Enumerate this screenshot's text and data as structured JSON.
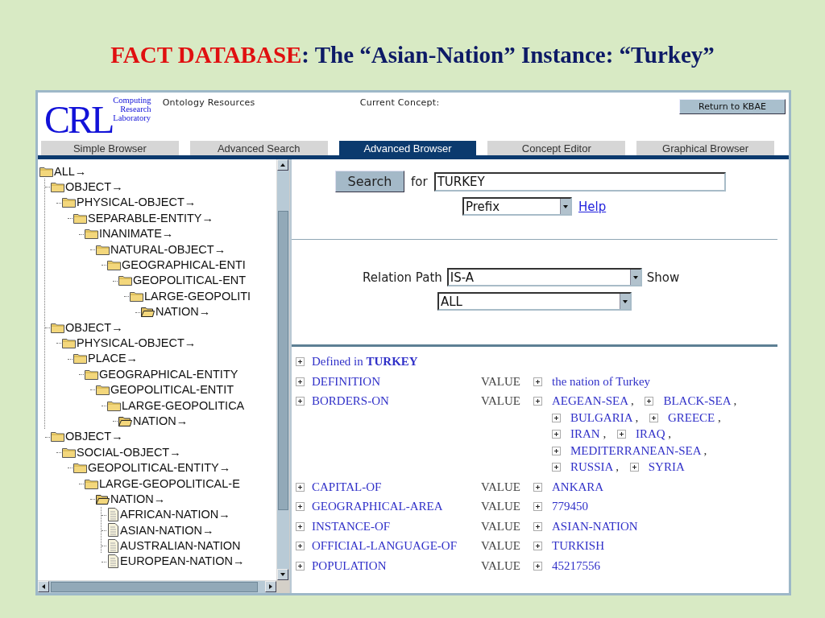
{
  "slide_title": {
    "highlight": "FACT DATABASE",
    "text": ": The “Asian-Nation” Instance: “Turkey”"
  },
  "header": {
    "logo": "CRL",
    "logo_lines": [
      "Computing",
      "Research",
      "Laboratory"
    ],
    "labels": [
      "Ontology Resources",
      "Current Concept:"
    ],
    "button": "Return to KBAE"
  },
  "tabs": [
    {
      "label": "Simple Browser",
      "selected": false
    },
    {
      "label": "Advanced Search",
      "selected": false
    },
    {
      "label": "Advanced Browser",
      "selected": true
    },
    {
      "label": "Concept Editor",
      "selected": false
    },
    {
      "label": "Graphical Browser",
      "selected": false
    }
  ],
  "tree": [
    {
      "label": "ALL→",
      "kind": "folder",
      "children": [
        {
          "label": "OBJECT→",
          "kind": "folder",
          "children": [
            {
              "label": "PHYSICAL-OBJECT→",
              "kind": "folder",
              "children": [
                {
                  "label": "SEPARABLE-ENTITY→",
                  "kind": "folder",
                  "children": [
                    {
                      "label": "INANIMATE→",
                      "kind": "folder",
                      "children": [
                        {
                          "label": "NATURAL-OBJECT→",
                          "kind": "folder",
                          "children": [
                            {
                              "label": "GEOGRAPHICAL-ENTI",
                              "kind": "folder",
                              "children": [
                                {
                                  "label": "GEOPOLITICAL-ENT",
                                  "kind": "folder",
                                  "children": [
                                    {
                                      "label": "LARGE-GEOPOLITI",
                                      "kind": "folder",
                                      "children": [
                                        {
                                          "label": "NATION→",
                                          "kind": "open"
                                        }
                                      ]
                                    }
                                  ]
                                }
                              ]
                            }
                          ]
                        }
                      ]
                    }
                  ]
                }
              ]
            }
          ]
        },
        {
          "label": "OBJECT→",
          "kind": "folder",
          "children": [
            {
              "label": "PHYSICAL-OBJECT→",
              "kind": "folder",
              "children": [
                {
                  "label": "PLACE→",
                  "kind": "folder",
                  "children": [
                    {
                      "label": "GEOGRAPHICAL-ENTITY",
                      "kind": "folder",
                      "children": [
                        {
                          "label": "GEOPOLITICAL-ENTIT",
                          "kind": "folder",
                          "children": [
                            {
                              "label": "LARGE-GEOPOLITICA",
                              "kind": "folder",
                              "children": [
                                {
                                  "label": "NATION→",
                                  "kind": "open"
                                }
                              ]
                            }
                          ]
                        }
                      ]
                    }
                  ]
                }
              ]
            }
          ]
        },
        {
          "label": "OBJECT→",
          "kind": "folder",
          "children": [
            {
              "label": "SOCIAL-OBJECT→",
              "kind": "folder",
              "children": [
                {
                  "label": "GEOPOLITICAL-ENTITY→",
                  "kind": "folder",
                  "children": [
                    {
                      "label": "LARGE-GEOPOLITICAL-E",
                      "kind": "folder",
                      "children": [
                        {
                          "label": "NATION→",
                          "kind": "open",
                          "children": [
                            {
                              "label": "AFRICAN-NATION→",
                              "kind": "document"
                            },
                            {
                              "label": "ASIAN-NATION→",
                              "kind": "document"
                            },
                            {
                              "label": "AUSTRALIAN-NATION",
                              "kind": "document"
                            },
                            {
                              "label": "EUROPEAN-NATION→",
                              "kind": "document"
                            }
                          ]
                        }
                      ]
                    }
                  ]
                }
              ]
            }
          ]
        }
      ]
    }
  ],
  "search": {
    "button": "Search",
    "for_label": "for",
    "query": "TURKEY",
    "match_mode": "Prefix",
    "help_link": "Help",
    "relation_label": "Relation Path",
    "relation": "IS-A",
    "show_label": "Show",
    "show": "ALL"
  },
  "defined_in": "Defined in **TURKEY**",
  "properties": [
    {
      "name": "DEFINITION",
      "value_label": "VALUE",
      "values": [
        {
          "label": "the nation of Turkey"
        }
      ]
    },
    {
      "name": "BORDERS-ON",
      "value_label": "VALUE",
      "values": [
        {
          "label": "AEGEAN-SEA",
          "separator": ","
        },
        {
          "label": "BLACK-SEA",
          "separator": ","
        },
        {
          "label": "BULGARIA",
          "separator": ","
        },
        {
          "label": "GREECE",
          "separator": ","
        },
        {
          "label": "IRAN",
          "separator": ","
        },
        {
          "label": "IRAQ",
          "separator": ","
        },
        {
          "label": "MEDITERRANEAN-SEA",
          "separator": ","
        },
        {
          "label": "RUSSIA",
          "separator": ","
        },
        {
          "label": "SYRIA"
        }
      ]
    },
    {
      "name": "CAPITAL-OF",
      "value_label": "VALUE",
      "values": [
        {
          "label": "ANKARA"
        }
      ]
    },
    {
      "name": "GEOGRAPHICAL-AREA",
      "value_label": "VALUE",
      "values": [
        {
          "label": "779450"
        }
      ]
    },
    {
      "name": "INSTANCE-OF",
      "value_label": "VALUE",
      "values": [
        {
          "label": "ASIAN-NATION"
        }
      ]
    },
    {
      "name": "OFFICIAL-LANGUAGE-OF",
      "value_label": "VALUE",
      "values": [
        {
          "label": "TURKISH"
        }
      ]
    },
    {
      "name": "POPULATION",
      "value_label": "VALUE",
      "values": [
        {
          "label": "45217556"
        }
      ]
    }
  ]
}
